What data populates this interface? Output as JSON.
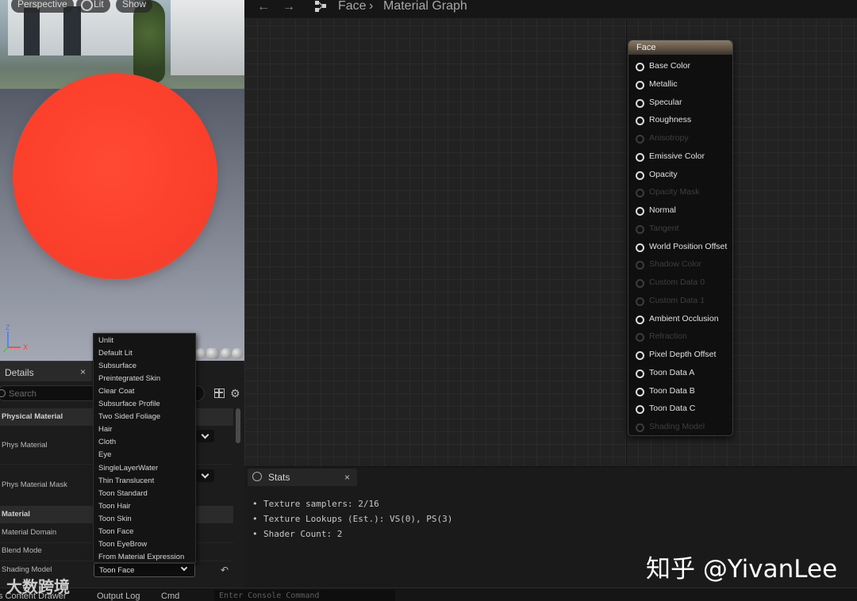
{
  "viewport": {
    "buttons": {
      "perspective": "Perspective",
      "lit": "Lit",
      "show": "Show"
    },
    "axis": {
      "z": "Z",
      "x": "X"
    },
    "sphere_color": "#fb3f2b"
  },
  "graph_header": {
    "breadcrumb_asset": "Face",
    "breadcrumb_sep": "›",
    "breadcrumb_graph": "Material Graph"
  },
  "node": {
    "title": "Face",
    "pins": [
      {
        "label": "Base Color",
        "enabled": true
      },
      {
        "label": "Metallic",
        "enabled": true
      },
      {
        "label": "Specular",
        "enabled": true
      },
      {
        "label": "Roughness",
        "enabled": true
      },
      {
        "label": "Anisotropy",
        "enabled": false
      },
      {
        "label": "Emissive Color",
        "enabled": true
      },
      {
        "label": "Opacity",
        "enabled": true
      },
      {
        "label": "Opacity Mask",
        "enabled": false
      },
      {
        "label": "Normal",
        "enabled": true
      },
      {
        "label": "Tangent",
        "enabled": false
      },
      {
        "label": "World Position Offset",
        "enabled": true
      },
      {
        "label": "Shadow Color",
        "enabled": false
      },
      {
        "label": "Custom Data 0",
        "enabled": false
      },
      {
        "label": "Custom Data 1",
        "enabled": false
      },
      {
        "label": "Ambient Occlusion",
        "enabled": true
      },
      {
        "label": "Refraction",
        "enabled": false
      },
      {
        "label": "Pixel Depth Offset",
        "enabled": true
      },
      {
        "label": "Toon Data A",
        "enabled": true
      },
      {
        "label": "Toon Data B",
        "enabled": true
      },
      {
        "label": "Toon Data C",
        "enabled": true
      },
      {
        "label": "Shading Model",
        "enabled": false
      }
    ]
  },
  "details": {
    "tab_title": "Details",
    "close": "×",
    "search_placeholder": "Search",
    "categories": {
      "physical_material": "Physical Material",
      "material": "Material"
    },
    "properties": {
      "phys_material": "Phys Material",
      "phys_material_mask": "Phys Material Mask",
      "material_domain": "Material Domain",
      "blend_mode": "Blend Mode",
      "shading_model": "Shading Model"
    },
    "shading_model_value": "Toon Face"
  },
  "dropdown": {
    "options": [
      "Unlit",
      "Default Lit",
      "Subsurface",
      "Preintegrated Skin",
      "Clear Coat",
      "Subsurface Profile",
      "Two Sided Foliage",
      "Hair",
      "Cloth",
      "Eye",
      "SingleLayerWater",
      "Thin Translucent",
      "Toon Standard",
      "Toon Hair",
      "Toon Skin",
      "Toon Face",
      "Toon EyeBrow",
      "From Material Expression"
    ]
  },
  "stats": {
    "tab_title": "Stats",
    "close": "×",
    "lines": [
      "Texture samplers: 2/16",
      "Texture Lookups (Est.): VS(0), PS(3)",
      "Shader Count: 2"
    ]
  },
  "bottombar": {
    "content_drawer": "s Content Drawer",
    "output_log": "Output Log",
    "cmd": "Cmd",
    "console_placeholder": "Enter Console Command"
  },
  "watermarks": {
    "zhihu": "知乎 @YivanLee",
    "logo": "大数跨境"
  }
}
